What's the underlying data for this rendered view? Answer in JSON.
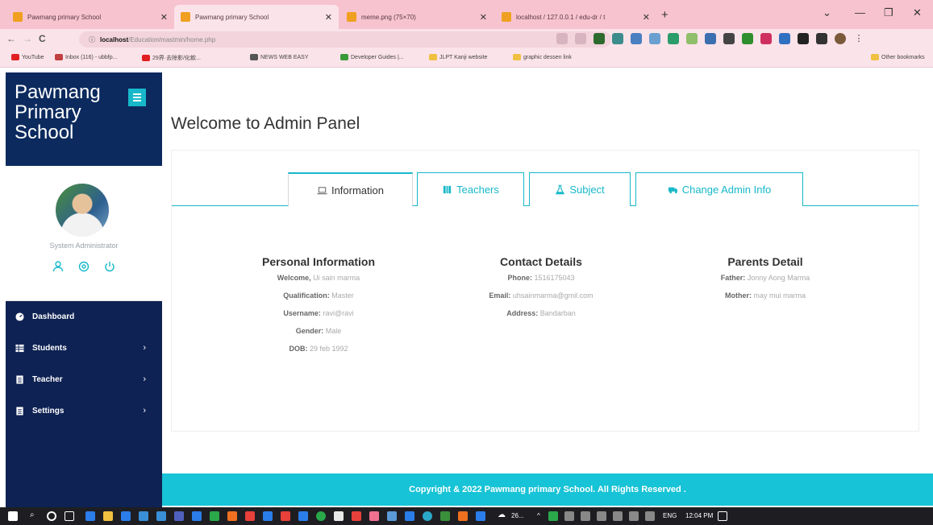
{
  "browser": {
    "tabs": [
      {
        "title": "Pawmang primary School",
        "color": "#f0a020"
      },
      {
        "title": "Pawmang primary School",
        "color": "#f0a020"
      },
      {
        "title": "meme.png (75×70)",
        "color": "#f0a020"
      },
      {
        "title": "localhost / 127.0.0.1 / edu-dr / t",
        "color": "#f0a020"
      }
    ],
    "url_scheme": "ⓘ",
    "url_host": "localhost",
    "url_path": "/Education/mastmin/home.php",
    "bookmarks": [
      "YouTube",
      "Inbox (116) - ubbfp...",
      "29界·去除影/化軟...",
      "NEWS WEB EASY",
      "Developer Guides |...",
      "JLPT Kanji website",
      "graphic dessen link",
      "Other bookmarks"
    ]
  },
  "sidebar": {
    "brand": "Pawmang Primary School",
    "role": "System Administrator",
    "nav": [
      {
        "label": "Dashboard",
        "icon": "dashboard-icon",
        "has_children": false
      },
      {
        "label": "Students",
        "icon": "grid-icon",
        "has_children": true
      },
      {
        "label": "Teacher",
        "icon": "document-icon",
        "has_children": true
      },
      {
        "label": "Settings",
        "icon": "document-icon",
        "has_children": true
      }
    ]
  },
  "main": {
    "title": "Welcome to Admin Panel",
    "tabs": [
      {
        "label": "Information",
        "icon": "laptop-icon",
        "active": true
      },
      {
        "label": "Teachers",
        "icon": "users-icon",
        "active": false
      },
      {
        "label": "Subject",
        "icon": "flask-icon",
        "active": false
      },
      {
        "label": "Change Admin Info",
        "icon": "truck-icon",
        "active": false
      }
    ],
    "personal": {
      "heading": "Personal Information",
      "rows": [
        {
          "k": "Welcome,",
          "v": "Ui sain marma"
        },
        {
          "k": "Qualification:",
          "v": "Master"
        },
        {
          "k": "Username:",
          "v": "ravi@ravi"
        },
        {
          "k": "Gender:",
          "v": "Male"
        },
        {
          "k": "DOB:",
          "v": "29 feb 1992"
        }
      ]
    },
    "contact": {
      "heading": "Contact Details",
      "rows": [
        {
          "k": "Phone:",
          "v": "1516175043"
        },
        {
          "k": "Email:",
          "v": "uhsainmarma@gmil.com"
        },
        {
          "k": "Address:",
          "v": "Bandarban"
        }
      ]
    },
    "parents": {
      "heading": "Parents Detail",
      "rows": [
        {
          "k": "Father:",
          "v": "Jonny Aong Marma"
        },
        {
          "k": "Mother:",
          "v": "may mui marma"
        }
      ]
    }
  },
  "footer": "Copyright & 2022 Pawmang primary School. All Rights Reserved .",
  "taskbar": {
    "weather": "26...",
    "lang": "ENG",
    "time": "12:04 PM"
  },
  "colors": {
    "accent": "#17b8c9",
    "sidebar": "#0e2253",
    "brand": "#0c2a5e"
  }
}
